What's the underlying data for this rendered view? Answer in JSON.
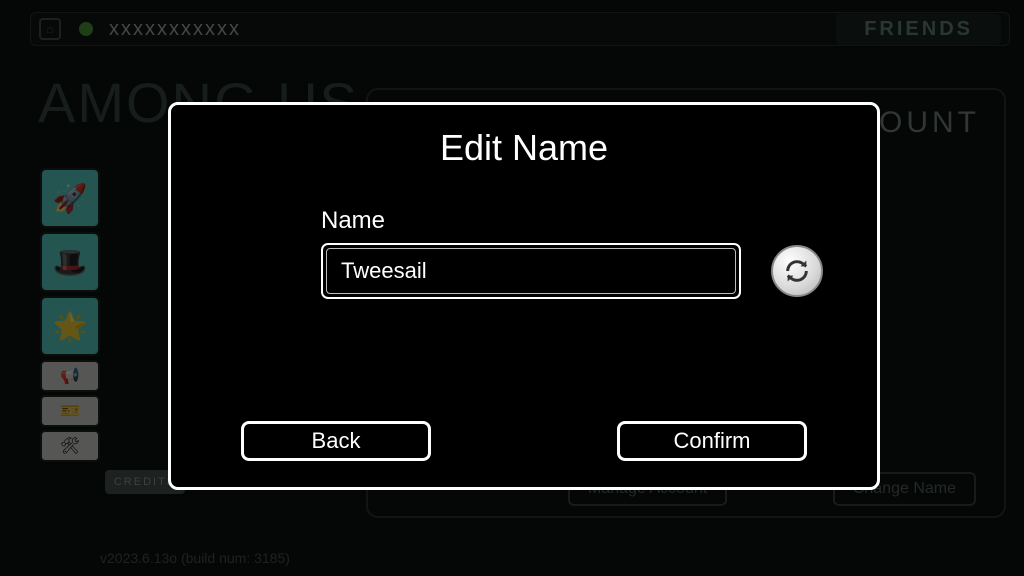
{
  "topBar": {
    "username": "xxxxxxxxxxx",
    "friendsLabel": "FRIENDS"
  },
  "gameTitle": "AMONG US",
  "sidebar": {
    "creditsLabel": "CREDITS"
  },
  "accountPanel": {
    "title": "ACCOUNT",
    "manageLabel": "Manage Account",
    "changeLabel": "Change Name"
  },
  "versionText": "v2023.6.13o (build num: 3185)",
  "modal": {
    "title": "Edit Name",
    "nameLabel": "Name",
    "nameValue": "Tweesail",
    "backLabel": "Back",
    "confirmLabel": "Confirm"
  }
}
